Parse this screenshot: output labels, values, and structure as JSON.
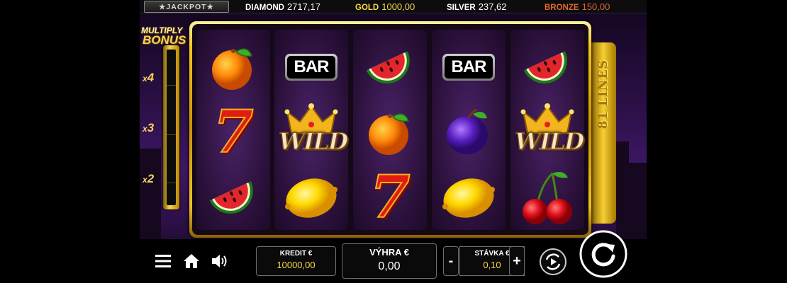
{
  "jackpot": {
    "logo": "★JACKPOT★",
    "diamond": {
      "label": "DIAMOND",
      "value": "2717,17"
    },
    "gold": {
      "label": "GOLD",
      "value": "1000,00"
    },
    "silver": {
      "label": "SILVER",
      "value": "237,62"
    },
    "bronze": {
      "label": "BRONZE",
      "value": "150,00"
    },
    "colors": {
      "gold": "#f8d84a",
      "bronze": "#e0682a",
      "silver": "#ffffff",
      "diamond": "#ffffff"
    }
  },
  "multiplier": {
    "title_line1": "MULTIPLY",
    "title_line2": "BONUS",
    "levels": [
      {
        "prefix": "x",
        "value": "4"
      },
      {
        "prefix": "x",
        "value": "3"
      },
      {
        "prefix": "x",
        "value": "2"
      }
    ]
  },
  "lines_label": "81 LINES",
  "reels": [
    [
      "orange-icon",
      "seven-icon",
      "watermelon-icon"
    ],
    [
      "bar-icon",
      "wild-icon",
      "lemon-icon"
    ],
    [
      "watermelon-icon",
      "orange-icon",
      "seven-icon"
    ],
    [
      "bar-icon",
      "plum-icon",
      "lemon-icon"
    ],
    [
      "watermelon-icon",
      "wild-icon",
      "cherry-icon"
    ]
  ],
  "symbol_text": {
    "bar": "BAR",
    "wild": "WILD",
    "seven": "7"
  },
  "controls": {
    "menu_icon": "menu-icon",
    "home_icon": "home-icon",
    "sound_icon": "sound-icon",
    "credit": {
      "label": "KREDIT €",
      "value": "10000,00"
    },
    "win": {
      "label": "VÝHRA €",
      "value": "0,00"
    },
    "bet": {
      "label": "STÁVKA €",
      "value": "0,10",
      "minus": "-",
      "plus": "+"
    },
    "autoplay_icon": "autoplay-icon",
    "spin_icon": "spin-icon"
  },
  "accent_colors": {
    "frame_gold": "#f4c51e",
    "value_yellow": "#f8d84a",
    "bg_purple": "#3d1766"
  }
}
